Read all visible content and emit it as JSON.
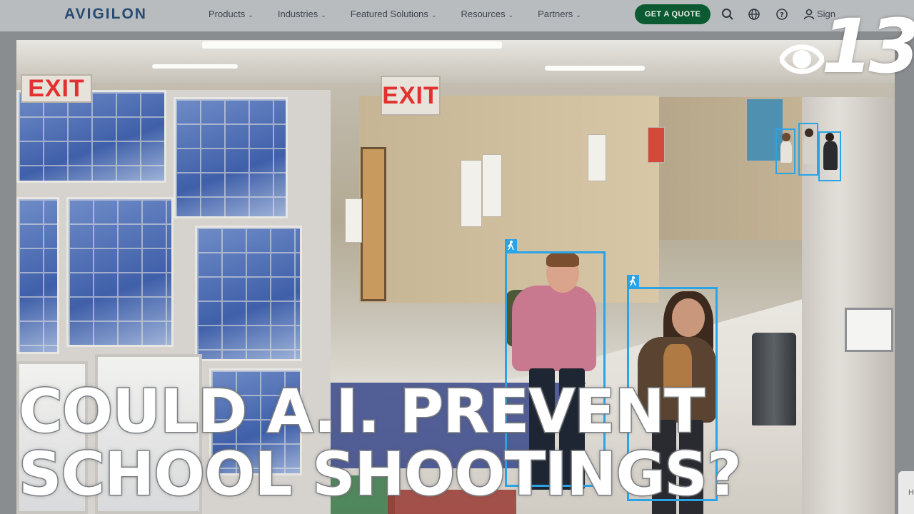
{
  "site": {
    "logo_text": "AVIGILON",
    "nav": [
      {
        "label": "Products"
      },
      {
        "label": "Industries"
      },
      {
        "label": "Featured Solutions"
      },
      {
        "label": "Resources"
      },
      {
        "label": "Partners"
      }
    ],
    "cta_label": "GET A QUOTE",
    "signin_label": "Sign"
  },
  "video": {
    "exit_left": "EXIT",
    "exit_center": "EXIT"
  },
  "headline": {
    "line1": "COULD A.I. PREVENT",
    "line2": "SCHOOL SHOOTINGS?"
  },
  "station": {
    "number": "13"
  },
  "overlay": {
    "close_glyph": "×",
    "corner_text": "H"
  },
  "colors": {
    "detection_box": "#2aa4e6",
    "cta_green": "#0b5a31",
    "logo_blue": "#274a72",
    "exit_red": "#e2322f"
  }
}
